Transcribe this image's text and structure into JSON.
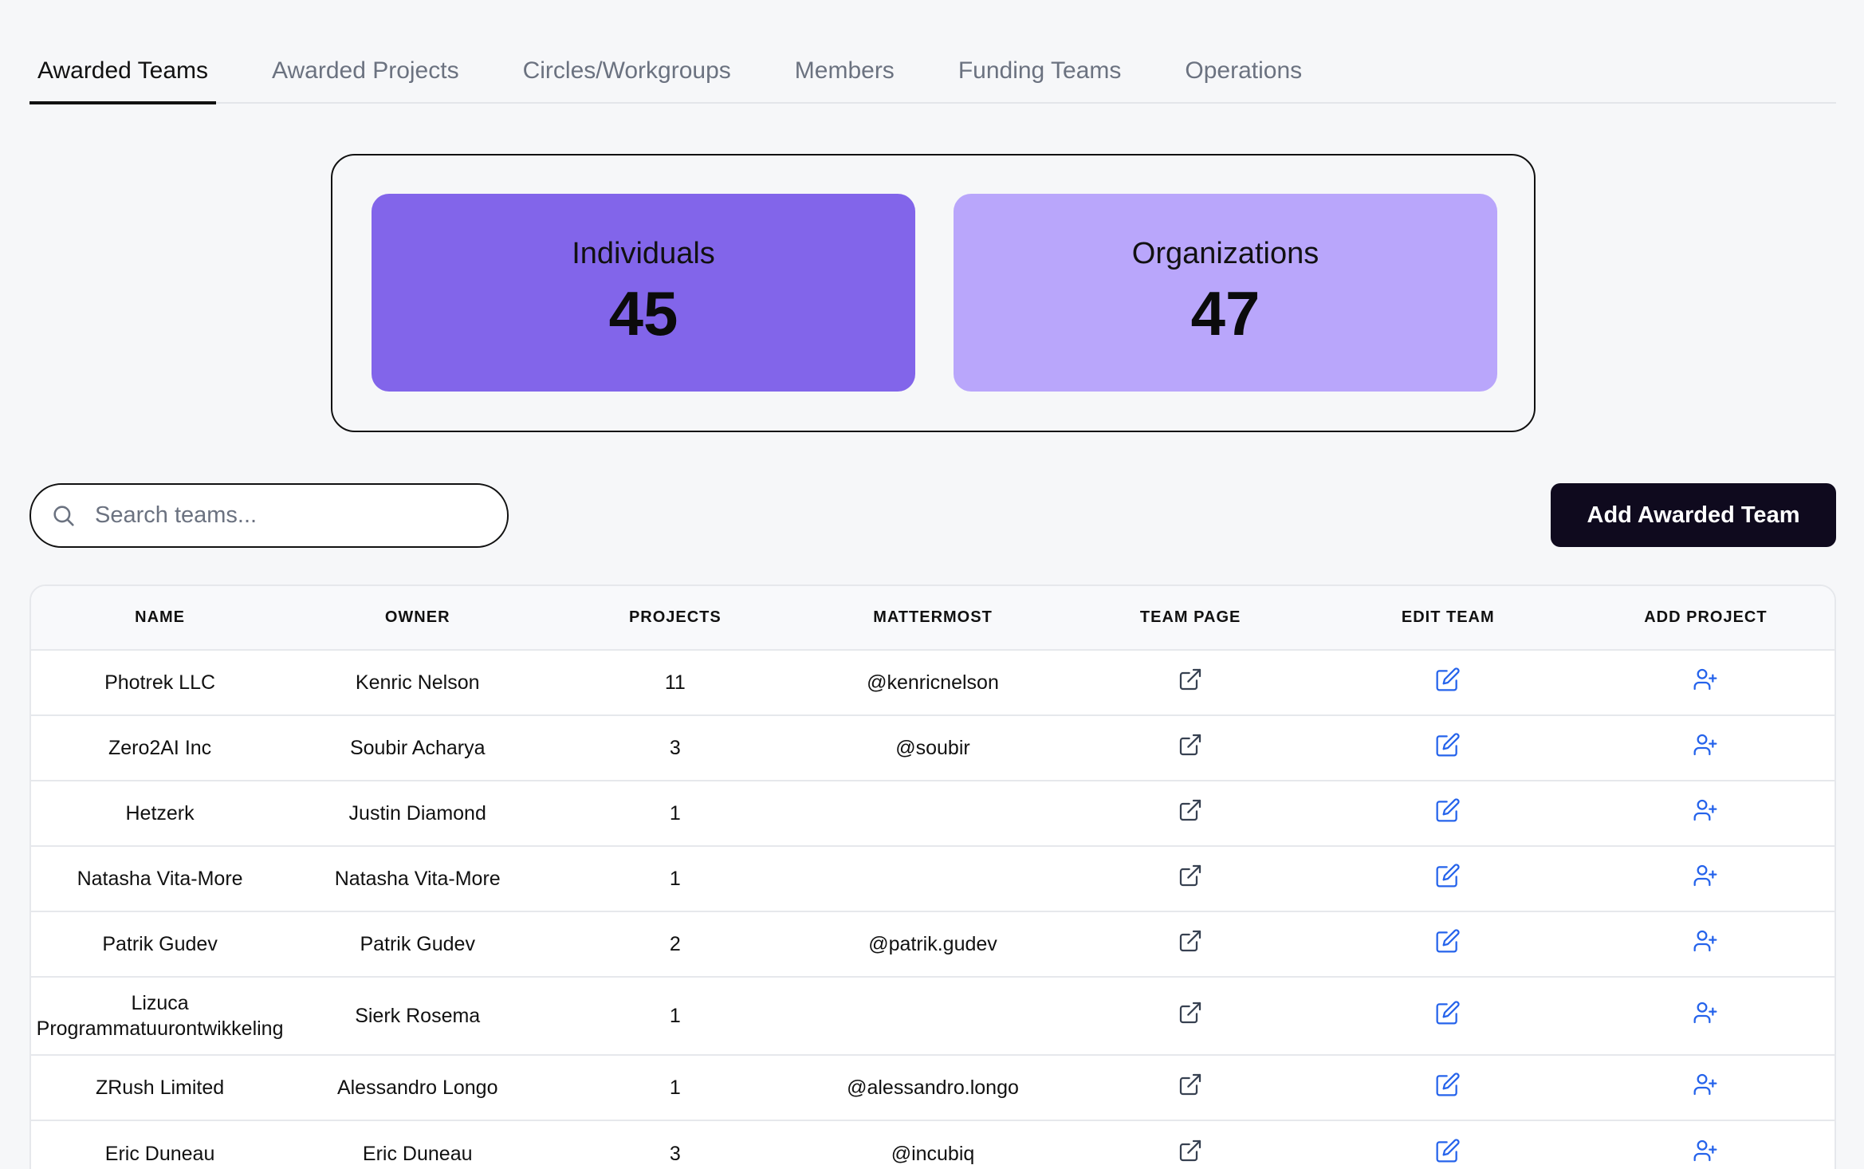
{
  "tabs": [
    {
      "label": "Awarded Teams",
      "active": true
    },
    {
      "label": "Awarded Projects",
      "active": false
    },
    {
      "label": "Circles/Workgroups",
      "active": false
    },
    {
      "label": "Members",
      "active": false
    },
    {
      "label": "Funding Teams",
      "active": false
    },
    {
      "label": "Operations",
      "active": false
    }
  ],
  "stats": {
    "individuals": {
      "label": "Individuals",
      "value": "45"
    },
    "organizations": {
      "label": "Organizations",
      "value": "47"
    }
  },
  "search": {
    "placeholder": "Search teams..."
  },
  "add_button": {
    "label": "Add Awarded Team"
  },
  "table": {
    "headers": [
      "NAME",
      "OWNER",
      "PROJECTS",
      "MATTERMOST",
      "TEAM PAGE",
      "EDIT TEAM",
      "ADD PROJECT"
    ],
    "rows": [
      {
        "name": "Photrek LLC",
        "owner": "Kenric Nelson",
        "projects": "11",
        "mattermost": "@kenricnelson"
      },
      {
        "name": "Zero2AI Inc",
        "owner": "Soubir Acharya",
        "projects": "3",
        "mattermost": "@soubir"
      },
      {
        "name": "Hetzerk",
        "owner": "Justin Diamond",
        "projects": "1",
        "mattermost": ""
      },
      {
        "name": "Natasha Vita-More",
        "owner": "Natasha Vita-More",
        "projects": "1",
        "mattermost": ""
      },
      {
        "name": "Patrik Gudev",
        "owner": "Patrik Gudev",
        "projects": "2",
        "mattermost": "@patrik.gudev"
      },
      {
        "name": "Lizuca Programmatuurontwikkeling",
        "owner": "Sierk Rosema",
        "projects": "1",
        "mattermost": ""
      },
      {
        "name": "ZRush Limited",
        "owner": "Alessandro Longo",
        "projects": "1",
        "mattermost": "@alessandro.longo"
      },
      {
        "name": "Eric Duneau",
        "owner": "Eric Duneau",
        "projects": "3",
        "mattermost": "@incubiq"
      }
    ]
  },
  "colors": {
    "individuals_card": "#8265ea",
    "organizations_card": "#b9a6fb",
    "action_icon": "#2563eb",
    "primary_button": "#0f0a1e"
  },
  "icons": {
    "team_page": "external-link-icon",
    "edit_team": "edit-icon",
    "add_project": "user-plus-icon",
    "search": "search-icon"
  }
}
